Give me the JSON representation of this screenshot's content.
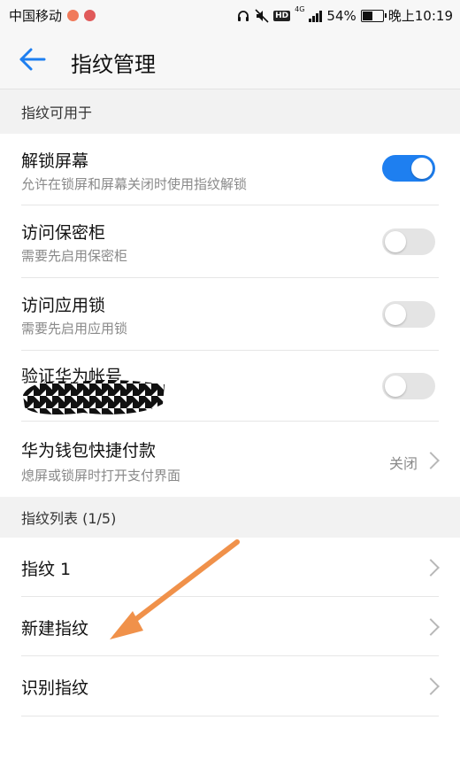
{
  "status_bar": {
    "carrier": "中国移动",
    "network": "4G",
    "battery": "54%",
    "time": "晚上10:19",
    "hd_label": "HD",
    "battery_level": 0.54,
    "colors": {
      "app_icon_1": "#f07a5a",
      "app_icon_2": "#e05a5a"
    }
  },
  "header": {
    "title": "指纹管理",
    "back_icon": "arrow-left-icon"
  },
  "sections": {
    "usage": {
      "title": "指纹可用于",
      "items": [
        {
          "title": "解锁屏幕",
          "subtitle": "允许在锁屏和屏幕关闭时使用指纹解锁",
          "toggle": true
        },
        {
          "title": "访问保密柜",
          "subtitle": "需要先启用保密柜",
          "toggle": false
        },
        {
          "title": "访问应用锁",
          "subtitle": "需要先启用应用锁",
          "toggle": false
        },
        {
          "title": "验证华为帐号",
          "subtitle": "",
          "toggle": false
        },
        {
          "title": "华为钱包快捷付款",
          "subtitle": "熄屏或锁屏时打开支付界面",
          "value": "关闭"
        }
      ]
    },
    "fingerprints": {
      "title": "指纹列表 (1/5)",
      "items": [
        {
          "title": "指纹 1"
        },
        {
          "title": "新建指纹"
        },
        {
          "title": "识别指纹"
        }
      ]
    }
  },
  "colors": {
    "toggle_on": "#1e7ff0",
    "toggle_off": "#e4e4e4",
    "back_arrow": "#1e7ff0",
    "annotation_arrow": "#f0914a"
  }
}
